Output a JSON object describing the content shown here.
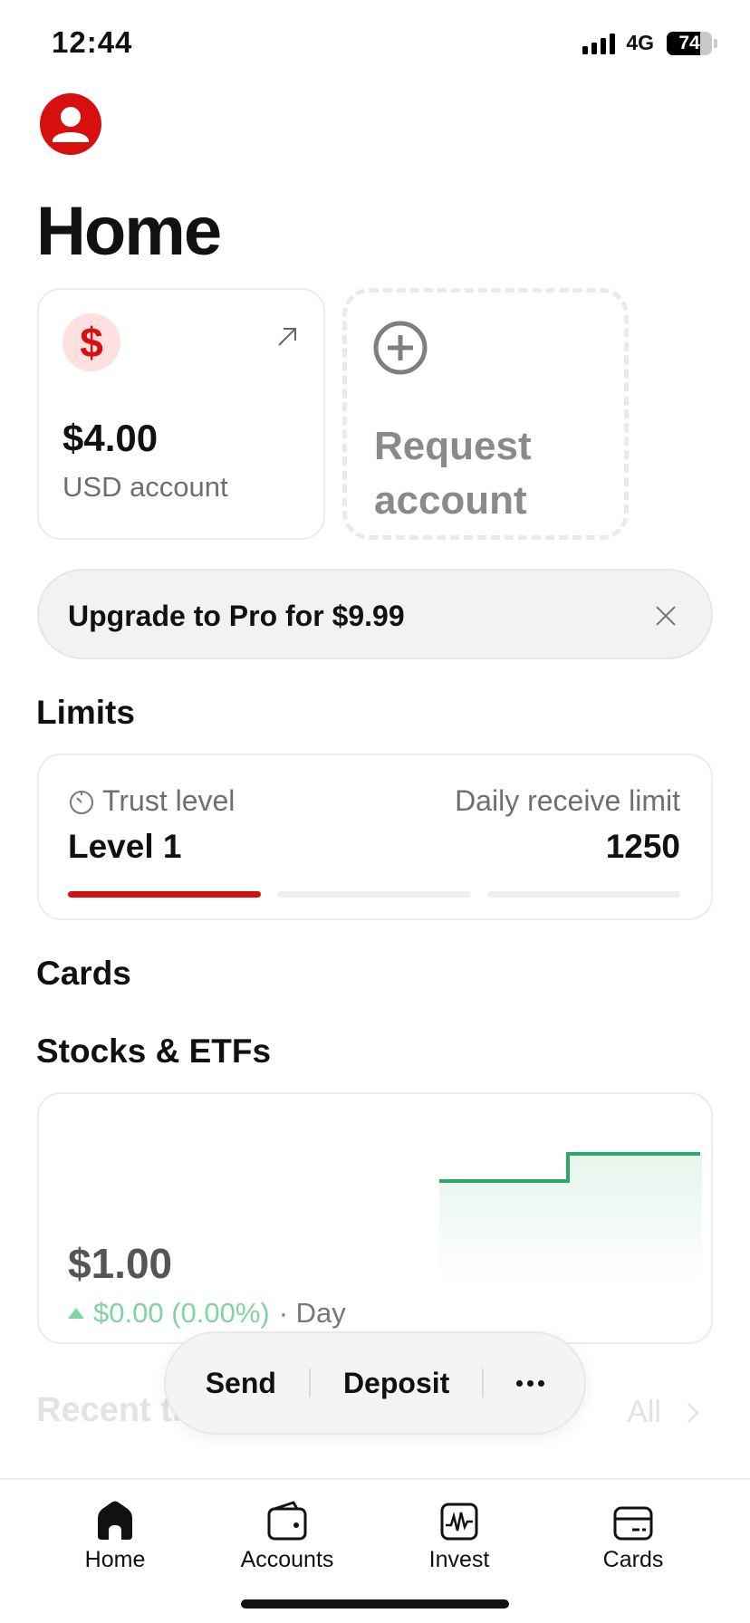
{
  "status": {
    "time": "12:44",
    "network": "4G",
    "battery": "74",
    "battery_fraction": 0.74
  },
  "page": {
    "title": "Home"
  },
  "account": {
    "currency_symbol": "$",
    "balance": "$4.00",
    "label": "USD account"
  },
  "request_account": {
    "label": "Request account"
  },
  "upgrade_banner": {
    "text": "Upgrade to Pro for $9.99"
  },
  "limits": {
    "heading": "Limits",
    "trust_label": "Trust level",
    "trust_value": "Level 1",
    "limit_label": "Daily receive limit",
    "limit_value": "1250",
    "progress_segments_filled": 1,
    "progress_segments_total": 3
  },
  "cards_section": {
    "heading": "Cards"
  },
  "stocks": {
    "heading": "Stocks & ETFs",
    "value": "$1.00",
    "change": "$0.00 (0.00%)",
    "period": "· Day"
  },
  "recent": {
    "heading": "Recent tr",
    "all_label": "All"
  },
  "actions": {
    "send": "Send",
    "deposit": "Deposit"
  },
  "tabs": [
    {
      "label": "Home",
      "icon": "home-icon"
    },
    {
      "label": "Accounts",
      "icon": "wallet-icon"
    },
    {
      "label": "Invest",
      "icon": "invest-chart-icon"
    },
    {
      "label": "Cards",
      "icon": "card-icon"
    }
  ],
  "colors": {
    "brand": "#d70f0f",
    "positive": "#2fa866",
    "muted": "#6f6f6f"
  }
}
